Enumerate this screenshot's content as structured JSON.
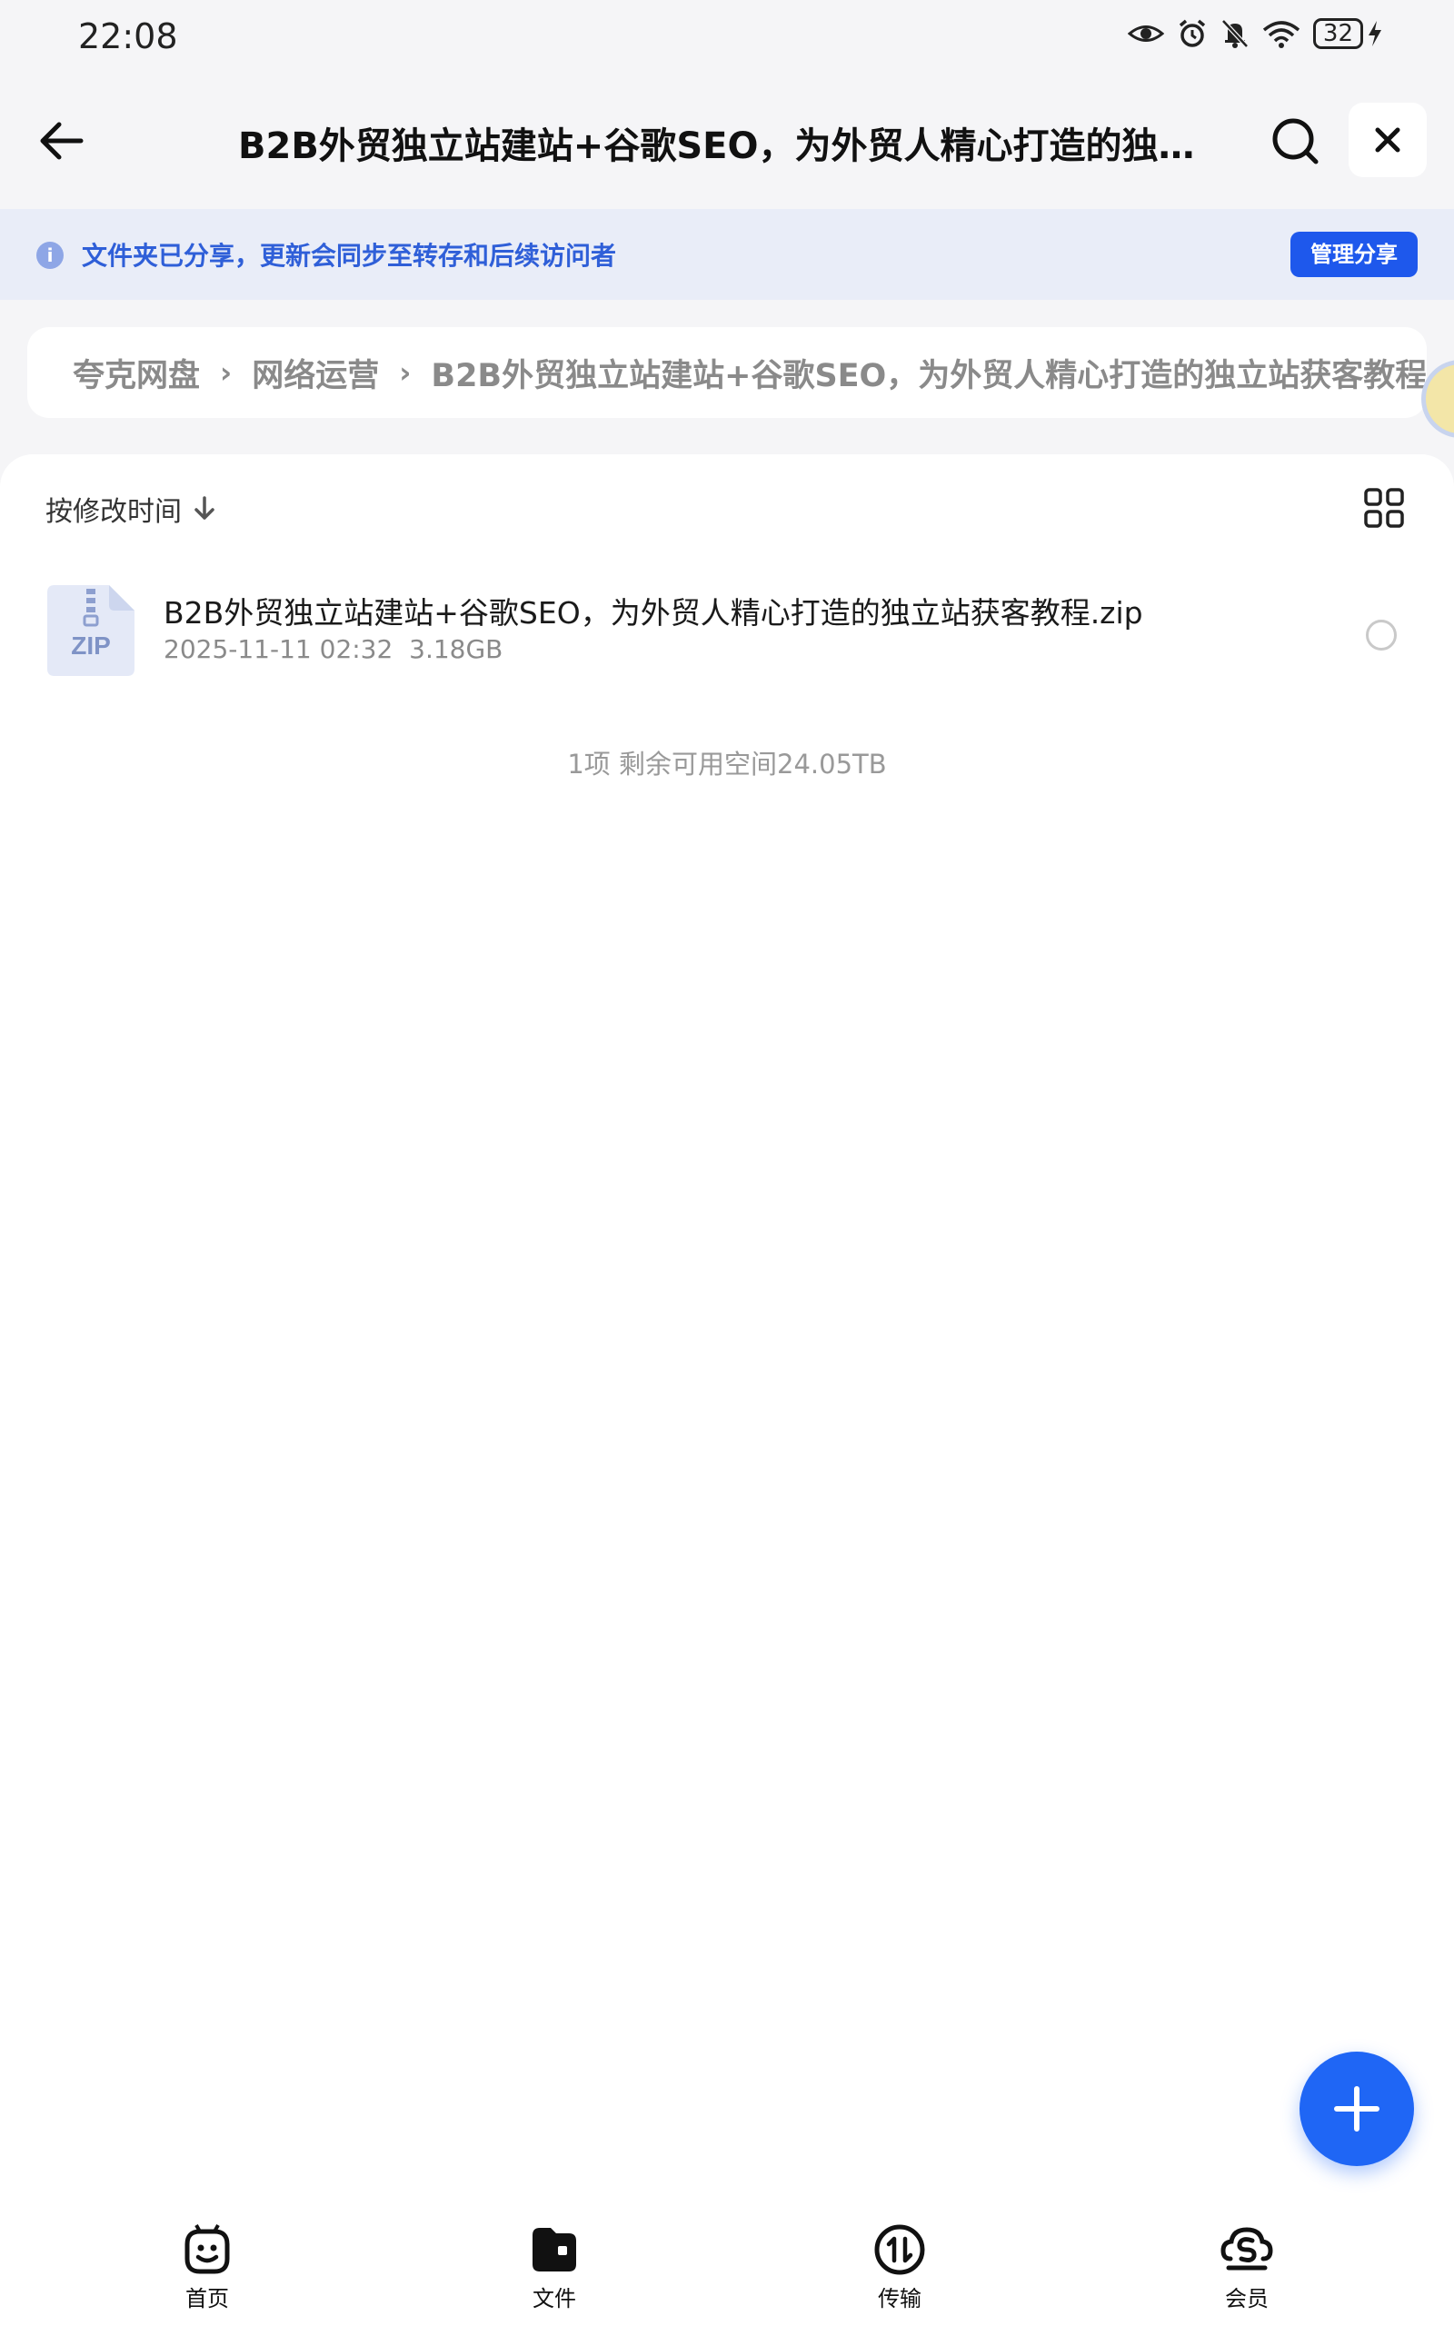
{
  "status": {
    "time": "22:08",
    "battery": "32"
  },
  "header": {
    "title": "B2B外贸独立站建站+谷歌SEO，为外贸人精心打造的独立..."
  },
  "notice": {
    "icon": "i",
    "text": "文件夹已分享，更新会同步至转存和后续访问者",
    "action": "管理分享"
  },
  "breadcrumb": [
    {
      "label": "夸克网盘"
    },
    {
      "label": "网络运营"
    },
    {
      "label": "B2B外贸独立站建站+谷歌SEO，为外贸人精心打造的独立站获客教程"
    }
  ],
  "list": {
    "sort_label": "按修改时间",
    "files": [
      {
        "icon": "zip-file-icon",
        "icon_text": "ZIP",
        "name": "B2B外贸独立站建站+谷歌SEO，为外贸人精心打造的独立站获客教程.zip",
        "modified": "2025-11-11 02:32",
        "size": "3.18GB"
      }
    ],
    "summary": "1项 剩余可用空间24.05TB"
  },
  "nav": {
    "items": [
      {
        "label": "首页",
        "icon": "home-face-icon"
      },
      {
        "label": "文件",
        "icon": "folder-icon"
      },
      {
        "label": "传输",
        "icon": "transfer-icon"
      },
      {
        "label": "会员",
        "icon": "member-icon"
      }
    ]
  },
  "colors": {
    "accent": "#1e58ec",
    "notice_bg": "#e9edf8",
    "notice_text": "#2f5fd8"
  }
}
